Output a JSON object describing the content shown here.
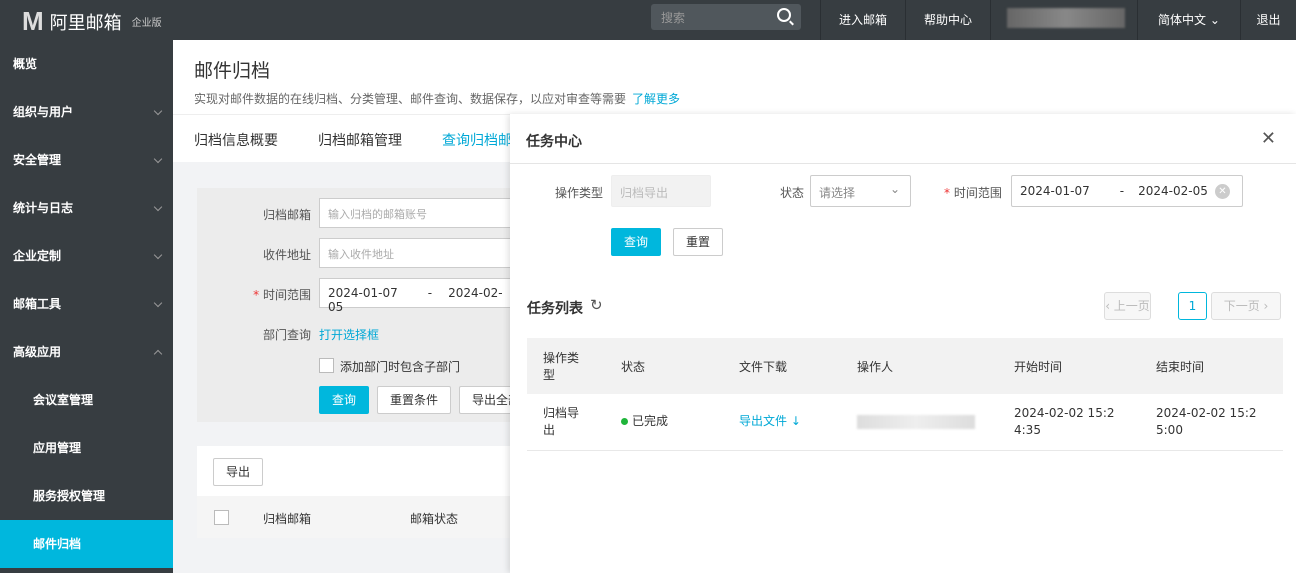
{
  "topbar": {
    "logo": "阿里邮箱",
    "edition": "企业版",
    "search_placeholder": "搜索",
    "nav": [
      "进入邮箱",
      "帮助中心",
      "简体中文",
      "退出"
    ]
  },
  "sidebar": {
    "items": [
      {
        "label": "概览"
      },
      {
        "label": "组织与用户"
      },
      {
        "label": "安全管理"
      },
      {
        "label": "统计与日志"
      },
      {
        "label": "企业定制"
      },
      {
        "label": "邮箱工具"
      },
      {
        "label": "高级应用"
      },
      {
        "label": "会议室管理"
      },
      {
        "label": "应用管理"
      },
      {
        "label": "服务授权管理"
      },
      {
        "label": "邮件归档"
      }
    ]
  },
  "page": {
    "title": "邮件归档",
    "desc": "实现对邮件数据的在线归档、分类管理、邮件查询、数据保存，以应对审查等需要",
    "learn_more": "了解更多",
    "tabs": [
      "归档信息概要",
      "归档邮箱管理",
      "查询归档邮"
    ]
  },
  "form": {
    "mailbox_label": "归档邮箱",
    "mailbox_placeholder": "输入归档的邮箱账号",
    "recv_label": "收件地址",
    "recv_placeholder": "输入收件地址",
    "time_label": "时间范围",
    "start": "2024-01-07",
    "sep": "-",
    "end": "2024-02-05",
    "dept_label": "部门查询",
    "dept_link": "打开选择框",
    "include_sub": "添加部门时包含子部门",
    "query": "查询",
    "reset": "重置条件",
    "export_all": "导出全部",
    "export": "导出",
    "col_mailbox": "归档邮箱",
    "col_status": "邮箱状态"
  },
  "panel": {
    "title": "任务中心",
    "op_type_label": "操作类型",
    "op_type_value": "归档导出",
    "status_label": "状态",
    "status_placeholder": "请选择",
    "time_label": "时间范围",
    "start": "2024-01-07",
    "sep": "-",
    "end": "2024-02-05",
    "query": "查询",
    "reset": "重置",
    "list_title": "任务列表",
    "prev": "‹ 上一页",
    "page": "1",
    "next": "下一页 ›",
    "columns": [
      "操作类型",
      "状态",
      "文件下载",
      "操作人",
      "开始时间",
      "结束时间"
    ],
    "rows": [
      {
        "type": "归档导出",
        "status": "已完成",
        "download": "导出文件",
        "start": "2024-02-02 15:24:35",
        "end": "2024-02-02 15:25:00"
      }
    ]
  }
}
